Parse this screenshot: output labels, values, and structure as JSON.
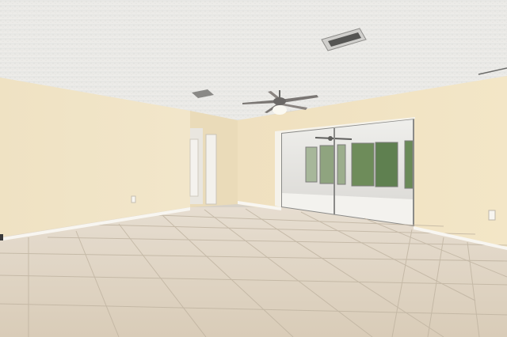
{
  "scene": {
    "type": "photo",
    "subject": "empty-room-interior",
    "elements": [
      "textured-ceiling",
      "ceiling-fan",
      "hvac-vent",
      "return-vent",
      "left-wall",
      "back-wall",
      "hallway-doorway",
      "closet-door",
      "sliding-glass-door",
      "sunroom",
      "sunroom-windows",
      "tile-floor",
      "baseboards",
      "wall-outlet"
    ]
  },
  "colors": {
    "ceiling": "#e9e8e5",
    "wall": "#ede0c2",
    "wall_shadow": "#e3d3b0",
    "floor_light": "#e0d6c8",
    "floor_dark": "#c9bdab",
    "grout": "#b8ab98",
    "trim": "#f7f5f0",
    "window_green": "#6e8c5a",
    "glass_frame": "#8a8a88"
  }
}
